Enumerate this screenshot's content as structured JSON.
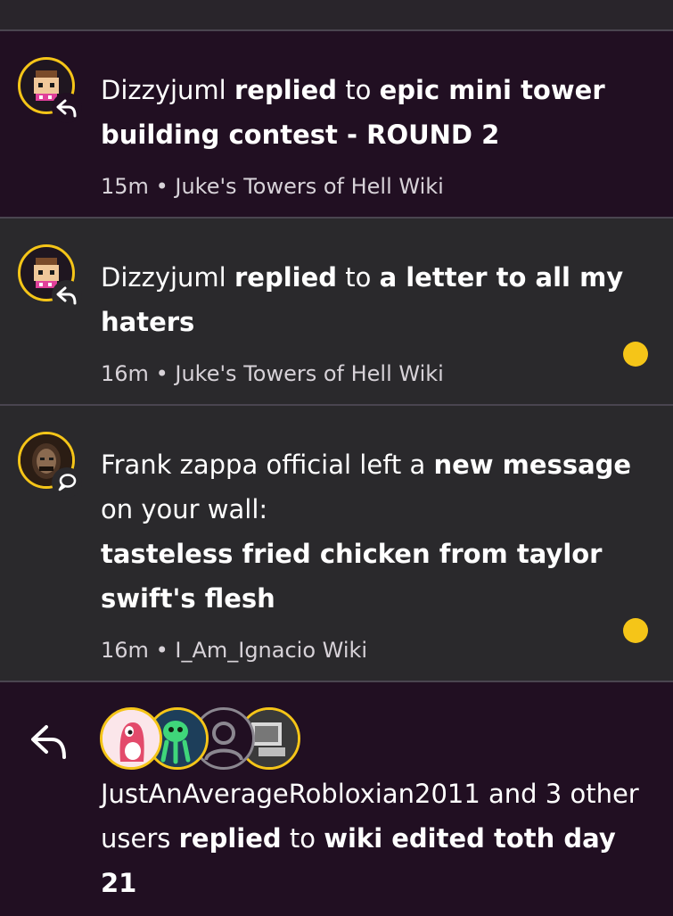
{
  "notifications": [
    {
      "user": "Dizzyjuml",
      "action": "replied",
      "connector": "to",
      "target": "epic mini tower building contest - ROUND 2",
      "time": "15m",
      "separator": "•",
      "wiki": "Juke's Towers of Hell Wiki",
      "unread": false,
      "badge_icon": "reply-icon"
    },
    {
      "user": "Dizzyjuml",
      "action": "replied",
      "connector": "to",
      "target": "a letter to all my haters",
      "time": "16m",
      "separator": "•",
      "wiki": "Juke's Towers of Hell Wiki",
      "unread": true,
      "badge_icon": "reply-icon"
    },
    {
      "user": "Frank zappa official",
      "action_prefix": "left a",
      "action": "new message",
      "action_suffix": "on your wall:",
      "target": "tasteless fried chicken from taylor swift's flesh",
      "time": "16m",
      "separator": "•",
      "wiki": "I_Am_Ignacio Wiki",
      "unread": true,
      "badge_icon": "speech-bubble-icon"
    }
  ],
  "group_notification": {
    "user": "JustAnAverageRobloxian2011",
    "others": "and 3 other users",
    "action": "replied",
    "connector": "to",
    "target": "wiki edited toth day 21",
    "icon": "reply-icon"
  },
  "colors": {
    "accent": "#f5c518",
    "read_bg": "#210f22",
    "unread_bg": "#2a292c"
  }
}
